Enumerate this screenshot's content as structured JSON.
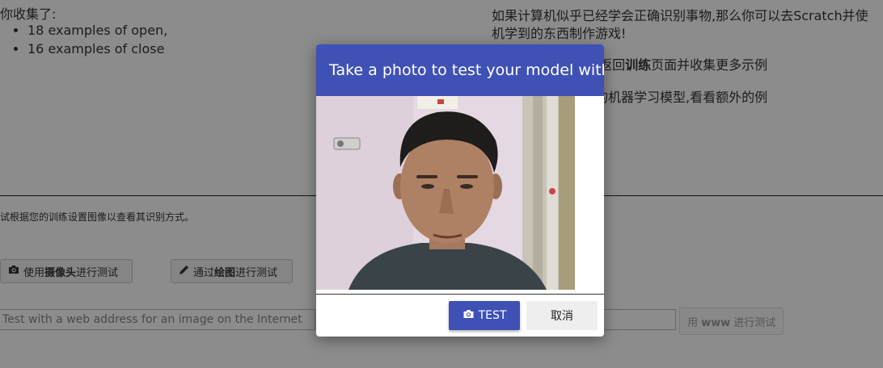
{
  "left_panel": {
    "summary": "你收集了:",
    "examples": [
      "18 examples of open,",
      "16 examples of close"
    ]
  },
  "right_panel": {
    "line1": "如果计算机似乎已经学会正确识别事物,那么你可以去Scratch并使",
    "line2": "机学到的东西制作游戏!",
    "line3_prefix": "多错误,您可能需要返回",
    "line3_bold": "训练",
    "line3_suffix": "页面并收集更多示例",
    "line4": "按钮来训练一个新的机器学习模型,看看额外的例"
  },
  "test_section": {
    "intro": "试根据您的训练设置图像以查看其识别方式。",
    "webcam_button": {
      "prefix": "使用",
      "bold": "摄像头",
      "suffix": "进行测试"
    },
    "draw_button": {
      "prefix": "通过",
      "bold": "绘图",
      "suffix": "进行测试"
    },
    "url_placeholder": "Test with a web address for an image on the Internet",
    "www_button": {
      "prefix": "用 ",
      "bold": "www",
      "suffix": " 进行测试"
    }
  },
  "modal": {
    "title": "Take a photo to test your model with",
    "test_label": "TEST",
    "cancel_label": "取消",
    "accent_color": "#3f51b5"
  },
  "icons": [
    "camera-icon",
    "pencil-icon"
  ]
}
